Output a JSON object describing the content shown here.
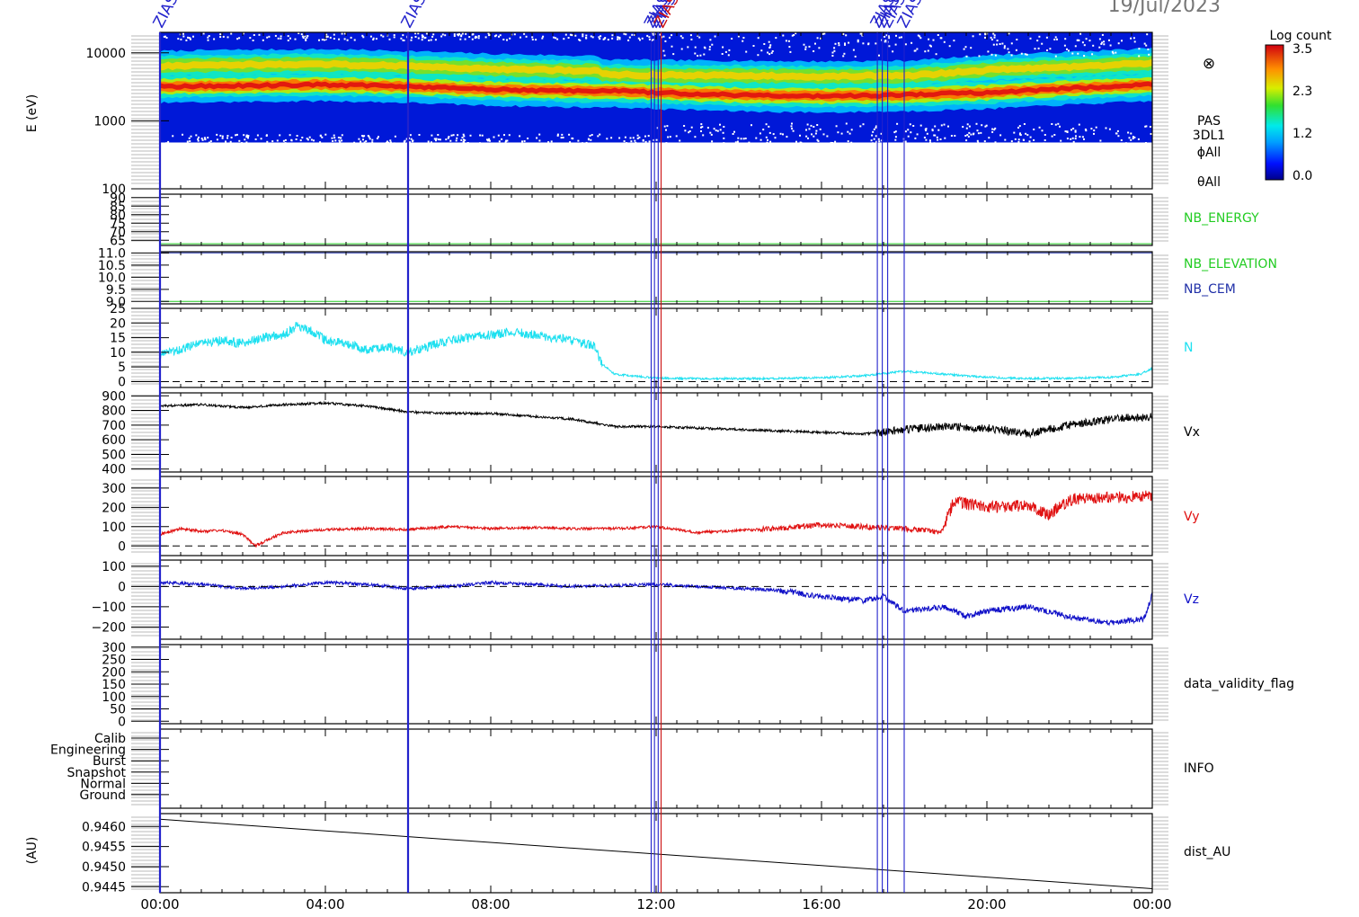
{
  "date_label": "19/Jul/2023",
  "colors": {
    "cyan": "#1ee0f0",
    "black": "#000000",
    "red": "#e01010",
    "blue": "#1010c8",
    "green": "#22cc22",
    "navy": "#2030a8",
    "marker_blue": "#2222cc",
    "marker_red": "#cc1111"
  },
  "event_markers": {
    "label": "ZIAS",
    "times_hours": [
      0.0,
      6.0,
      11.88,
      11.96,
      12.05,
      12.12,
      17.35,
      17.47,
      17.6,
      18.0
    ],
    "red_times_hours": [
      12.12
    ]
  },
  "time_axis": {
    "range_hours": [
      0,
      24
    ],
    "tick_hours": [
      0,
      4,
      8,
      12,
      16,
      20,
      24
    ],
    "tick_labels": [
      "00:00",
      "04:00",
      "08:00",
      "12:00",
      "16:00",
      "20:00",
      "00:00"
    ]
  },
  "colorbar": {
    "title": "Log count",
    "ticks": [
      "3.5",
      "2.3",
      "1.2",
      "0.0"
    ],
    "range": [
      0.0,
      3.5
    ]
  },
  "right_labels": {
    "spectrogram": [
      "PAS",
      "3DL1",
      "ϕAll",
      "θAll"
    ],
    "energy": "NB_ENERGY",
    "elevation": "NB_ELEVATION",
    "cem": "NB_CEM",
    "density": "N",
    "vx": "Vx",
    "vy": "Vy",
    "vz": "Vz",
    "validity": "data_validity_flag",
    "info": "INFO",
    "dist": "dist_AU"
  },
  "chart_data": [
    {
      "type": "heatmap",
      "panel": "spectrogram",
      "ylabel": "E (eV)",
      "yscale": "log",
      "ylim": [
        100,
        20000
      ],
      "y_tick_labels": [
        "10000",
        "1000",
        "100"
      ],
      "y_ticks": [
        10000,
        1000,
        100
      ],
      "z_label": "Log count",
      "bands": [
        {
          "name": "band1_keV",
          "x": [
            0,
            2,
            4,
            6,
            8,
            10.6,
            10.7,
            12,
            14,
            16,
            18,
            19,
            20,
            22,
            24
          ],
          "y": [
            3200,
            3300,
            3400,
            3200,
            2900,
            2700,
            2800,
            2600,
            2400,
            2300,
            2400,
            2500,
            2600,
            3000,
            3400
          ]
        },
        {
          "name": "band2_keV",
          "x": [
            0,
            2,
            4,
            6,
            8,
            10.6,
            10.7,
            12,
            14,
            16,
            18,
            19,
            20,
            22,
            24
          ],
          "y": [
            6400,
            6700,
            6800,
            6400,
            5800,
            5400,
            4800,
            4700,
            4600,
            4500,
            4600,
            5000,
            5600,
            6200,
            7000
          ]
        }
      ]
    },
    {
      "type": "line",
      "panel": "energy",
      "y_ticks": [
        65,
        70,
        75,
        80,
        85,
        90
      ],
      "y_tick_labels": [
        "65",
        "70",
        "75",
        "80",
        "85",
        "90"
      ],
      "ylim": [
        62,
        92
      ],
      "series": [
        {
          "name": "NB_ENERGY",
          "color": "#22cc22",
          "x": [
            0,
            24
          ],
          "y": [
            63,
            63
          ]
        }
      ]
    },
    {
      "type": "line",
      "panel": "elevation",
      "y_ticks": [
        9.0,
        9.5,
        10.0,
        10.5,
        11.0
      ],
      "y_tick_labels": [
        "9.0",
        "9.5",
        "10.0",
        "10.5",
        "11.0"
      ],
      "ylim": [
        8.9,
        11.05
      ],
      "series": [
        {
          "name": "NB_ELEVATION",
          "color": "#22cc22",
          "x": [
            0,
            24
          ],
          "y": [
            9.0,
            9.0
          ]
        },
        {
          "name": "NB_CEM",
          "color": "#2030a8",
          "x": [
            0,
            24
          ],
          "y": [
            11.0,
            11.0
          ]
        }
      ]
    },
    {
      "type": "line",
      "panel": "density",
      "y_ticks": [
        0,
        5,
        10,
        15,
        20,
        25
      ],
      "y_tick_labels": [
        "0",
        "5",
        "10",
        "15",
        "20",
        "25"
      ],
      "ylim": [
        -2,
        25
      ],
      "zero_line": true,
      "series": [
        {
          "name": "N",
          "color": "#1ee0f0",
          "x": [
            0,
            0.5,
            1,
            1.5,
            2,
            2.5,
            3,
            3.3,
            3.7,
            4,
            4.5,
            5,
            5.5,
            6,
            6.5,
            7,
            7.5,
            8,
            8.5,
            9,
            9.5,
            10,
            10.5,
            10.7,
            11,
            12,
            13,
            14,
            15,
            16,
            17,
            18,
            18.5,
            19,
            20,
            21,
            22,
            23,
            23.7,
            24
          ],
          "y": [
            9,
            11,
            13,
            14,
            13,
            15,
            16,
            19,
            17,
            14,
            13,
            11,
            12,
            10,
            12,
            14,
            15,
            16,
            17,
            16,
            15,
            14,
            12,
            6,
            2.5,
            1.2,
            1.0,
            1.0,
            1.1,
            1.3,
            2.0,
            3.5,
            3.0,
            2.5,
            1.5,
            1.0,
            1.2,
            1.5,
            2.5,
            4.5
          ]
        }
      ]
    },
    {
      "type": "line",
      "panel": "vx",
      "y_ticks": [
        400,
        500,
        600,
        700,
        800,
        900
      ],
      "y_tick_labels": [
        "400",
        "500",
        "600",
        "700",
        "800",
        "900"
      ],
      "ylim": [
        380,
        920
      ],
      "series": [
        {
          "name": "Vx",
          "color": "#000000",
          "x": [
            0,
            1,
            2,
            3,
            4,
            5,
            6,
            7,
            8,
            9,
            10,
            11,
            12,
            13,
            14,
            15,
            16,
            17,
            17.5,
            18,
            19,
            20,
            21,
            22,
            23,
            24
          ],
          "y": [
            830,
            840,
            820,
            840,
            850,
            830,
            790,
            780,
            780,
            760,
            740,
            690,
            690,
            680,
            670,
            660,
            650,
            640,
            650,
            670,
            690,
            680,
            640,
            700,
            740,
            760
          ]
        }
      ]
    },
    {
      "type": "line",
      "panel": "vy",
      "y_ticks": [
        0,
        100,
        200,
        300
      ],
      "y_tick_labels": [
        "0",
        "100",
        "200",
        "300"
      ],
      "ylim": [
        -50,
        360
      ],
      "zero_line": true,
      "series": [
        {
          "name": "Vy",
          "color": "#e01010",
          "x": [
            0,
            0.5,
            1,
            1.5,
            2,
            2.3,
            3,
            4,
            5,
            6,
            7,
            8,
            9,
            10,
            11,
            12,
            13,
            14,
            15,
            16,
            17,
            18,
            18.9,
            19.2,
            20,
            21,
            21.5,
            22,
            23,
            24
          ],
          "y": [
            60,
            90,
            75,
            80,
            60,
            0,
            70,
            85,
            90,
            85,
            100,
            90,
            95,
            90,
            90,
            100,
            70,
            80,
            90,
            110,
            100,
            90,
            70,
            230,
            200,
            210,
            160,
            240,
            250,
            260
          ]
        }
      ]
    },
    {
      "type": "line",
      "panel": "vz",
      "y_ticks": [
        -200,
        -100,
        0,
        100
      ],
      "y_tick_labels": [
        "−200",
        "−100",
        "0",
        "100"
      ],
      "ylim": [
        -260,
        130
      ],
      "zero_line": true,
      "series": [
        {
          "name": "Vz",
          "color": "#1010c8",
          "x": [
            0,
            1,
            2,
            3,
            4,
            5,
            6,
            7,
            8,
            9,
            10,
            11,
            12,
            13,
            14,
            15,
            16,
            17,
            17.5,
            18,
            19,
            19.5,
            20,
            21,
            22,
            23,
            23.8,
            24
          ],
          "y": [
            20,
            10,
            -10,
            0,
            20,
            10,
            -10,
            0,
            20,
            10,
            0,
            5,
            10,
            0,
            -10,
            -20,
            -50,
            -70,
            -50,
            -120,
            -100,
            -150,
            -120,
            -100,
            -150,
            -180,
            -160,
            -40
          ]
        }
      ]
    },
    {
      "type": "line",
      "panel": "validity",
      "y_ticks": [
        0,
        50,
        100,
        150,
        200,
        250,
        300
      ],
      "y_tick_labels": [
        "0",
        "50",
        "100",
        "150",
        "200",
        "250",
        "300"
      ],
      "ylim": [
        -10,
        310
      ],
      "series": []
    },
    {
      "type": "line",
      "panel": "info",
      "y_ticks": [
        0,
        1,
        2,
        3,
        4,
        5
      ],
      "y_tick_labels": [
        "Ground",
        "Normal",
        "Snapshot",
        "Burst",
        "Engineering",
        "Calib"
      ],
      "ylim": [
        -1.2,
        5.8
      ],
      "series": []
    },
    {
      "type": "line",
      "panel": "dist",
      "ylabel": "(AU)",
      "y_ticks": [
        0.9445,
        0.945,
        0.9455,
        0.946
      ],
      "y_tick_labels": [
        "0.9445",
        "0.9450",
        "0.9455",
        "0.9460"
      ],
      "ylim": [
        0.94435,
        0.94632
      ],
      "series": [
        {
          "name": "dist_AU",
          "color": "#000000",
          "x": [
            0,
            24
          ],
          "y": [
            0.94618,
            0.94445
          ]
        }
      ]
    }
  ]
}
